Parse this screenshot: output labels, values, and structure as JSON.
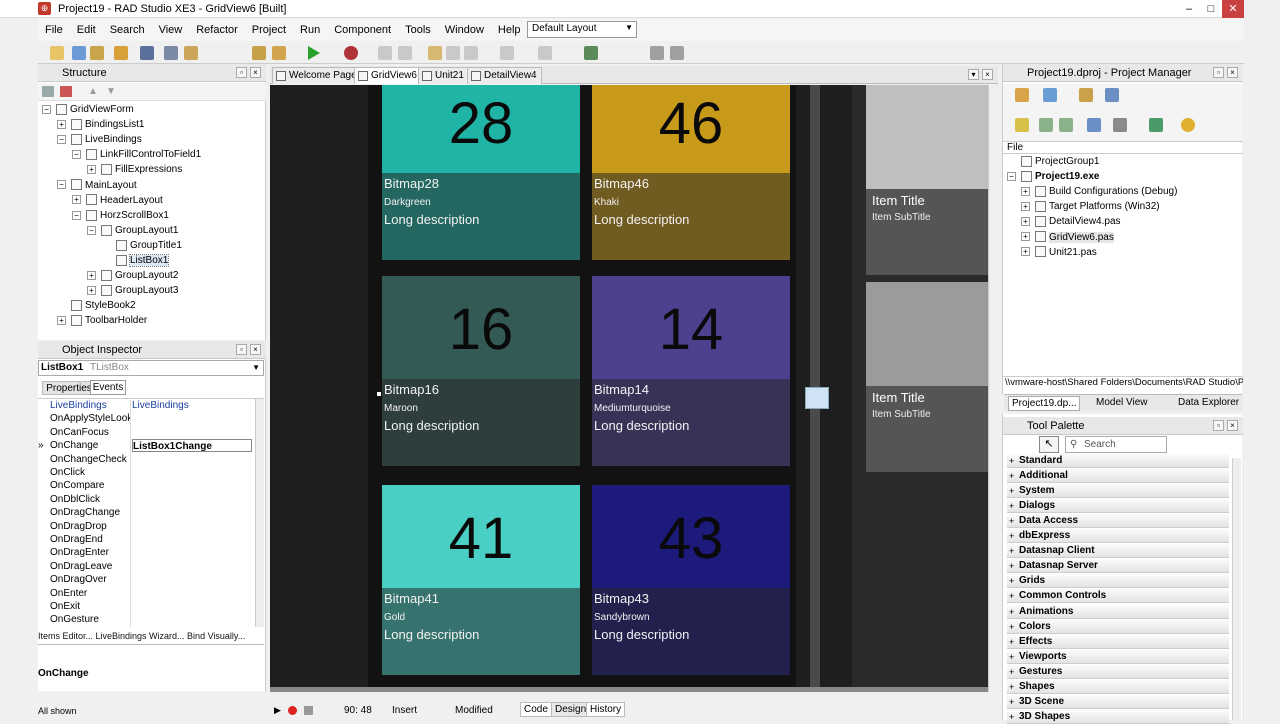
{
  "window": {
    "title": "Project19 - RAD Studio XE3 - GridView6 [Built]",
    "min": "–",
    "max": "□",
    "close": "✕"
  },
  "menu": [
    "File",
    "Edit",
    "Search",
    "View",
    "Refactor",
    "Project",
    "Run",
    "Component",
    "Tools",
    "Window",
    "Help"
  ],
  "layout": {
    "selected": "Default Layout"
  },
  "structure": {
    "title": "Structure",
    "rows": [
      {
        "label": "GridViewForm",
        "exp": "−",
        "depth": 0
      },
      {
        "label": "BindingsList1",
        "exp": "+",
        "depth": 1
      },
      {
        "label": "LiveBindings",
        "exp": "−",
        "depth": 1
      },
      {
        "label": "LinkFillControlToField1",
        "exp": "−",
        "depth": 2
      },
      {
        "label": "FillExpressions",
        "exp": "+",
        "depth": 3
      },
      {
        "label": "MainLayout",
        "exp": "−",
        "depth": 1
      },
      {
        "label": "HeaderLayout",
        "exp": "+",
        "depth": 2
      },
      {
        "label": "HorzScrollBox1",
        "exp": "−",
        "depth": 2
      },
      {
        "label": "GroupLayout1",
        "exp": "−",
        "depth": 3
      },
      {
        "label": "GroupTitle1",
        "exp": "",
        "depth": 4
      },
      {
        "label": "ListBox1",
        "exp": "",
        "depth": 4
      },
      {
        "label": "GroupLayout2",
        "exp": "+",
        "depth": 3
      },
      {
        "label": "GroupLayout3",
        "exp": "+",
        "depth": 3
      },
      {
        "label": "StyleBook2",
        "exp": "",
        "depth": 1
      },
      {
        "label": "ToolbarHolder",
        "exp": "+",
        "depth": 1
      }
    ]
  },
  "inspector": {
    "title": "Object Inspector",
    "object_name": "ListBox1",
    "object_type": "TListBox",
    "tabs": [
      "Properties",
      "Events"
    ],
    "rows": [
      {
        "name": "LiveBindings",
        "value": "LiveBindings"
      },
      {
        "name": "OnApplyStyleLookup",
        "value": ""
      },
      {
        "name": "OnCanFocus",
        "value": ""
      },
      {
        "name": "OnChange",
        "value": "ListBox1Change"
      },
      {
        "name": "OnChangeCheck",
        "value": ""
      },
      {
        "name": "OnClick",
        "value": ""
      },
      {
        "name": "OnCompare",
        "value": ""
      },
      {
        "name": "OnDblClick",
        "value": ""
      },
      {
        "name": "OnDragChange",
        "value": ""
      },
      {
        "name": "OnDragDrop",
        "value": ""
      },
      {
        "name": "OnDragEnd",
        "value": ""
      },
      {
        "name": "OnDragEnter",
        "value": ""
      },
      {
        "name": "OnDragLeave",
        "value": ""
      },
      {
        "name": "OnDragOver",
        "value": ""
      },
      {
        "name": "OnEnter",
        "value": ""
      },
      {
        "name": "OnExit",
        "value": ""
      },
      {
        "name": "OnGesture",
        "value": ""
      }
    ],
    "links": "Items Editor...  LiveBindings Wizard...  Bind Visually...",
    "selected_event": "OnChange",
    "footer": "All shown"
  },
  "editor": {
    "tabs": [
      "Welcome Page",
      "GridView6",
      "Unit21",
      "DetailView4"
    ],
    "tiles": [
      {
        "number": "28",
        "title": "Bitmap28",
        "subtitle": "Darkgreen",
        "desc": "Long description",
        "color": "#20b4a6"
      },
      {
        "number": "46",
        "title": "Bitmap46",
        "subtitle": "Khaki",
        "desc": "Long description",
        "color": "#c89a1a"
      },
      {
        "number": "16",
        "title": "Bitmap16",
        "subtitle": "Maroon",
        "desc": "Long description",
        "color": "#335a55"
      },
      {
        "number": "14",
        "title": "Bitmap14",
        "subtitle": "Mediumturquoise",
        "desc": "Long description",
        "color": "#4f3f8f"
      },
      {
        "number": "41",
        "title": "Bitmap41",
        "subtitle": "Gold",
        "desc": "Long description",
        "color": "#49cfc4"
      },
      {
        "number": "43",
        "title": "Bitmap43",
        "subtitle": "Sandybrown",
        "desc": "Long description",
        "color": "#1c1a7a"
      }
    ],
    "details": [
      {
        "title": "Item Title",
        "subtitle": "Item SubTitle",
        "img": "#bfbfbf"
      },
      {
        "title": "Item Title",
        "subtitle": "Item SubTitle",
        "img": "#9b9b9b"
      }
    ],
    "status": {
      "pos": "90:  48",
      "mode": "Insert",
      "state": "Modified",
      "views": [
        "Code",
        "Design",
        "History"
      ]
    }
  },
  "project_manager": {
    "title": "Project19.dproj - Project Manager",
    "col": "File",
    "rows": [
      {
        "label": "ProjectGroup1",
        "bold": false,
        "depth": 0,
        "exp": ""
      },
      {
        "label": "Project19.exe",
        "bold": true,
        "depth": 0,
        "exp": "−"
      },
      {
        "label": "Build Configurations (Debug)",
        "bold": false,
        "depth": 1,
        "exp": "+"
      },
      {
        "label": "Target Platforms (Win32)",
        "bold": false,
        "depth": 1,
        "exp": "+"
      },
      {
        "label": "DetailView4.pas",
        "bold": false,
        "depth": 1,
        "exp": "+"
      },
      {
        "label": "GridView6.pas",
        "bold": false,
        "depth": 1,
        "exp": "+"
      },
      {
        "label": "Unit21.pas",
        "bold": false,
        "depth": 1,
        "exp": "+"
      }
    ],
    "path": "\\\\vmware-host\\Shared Folders\\Documents\\RAD Studio\\Proj",
    "tabs": [
      "Project19.dp...",
      "Model View",
      "Data Explorer"
    ]
  },
  "palette": {
    "title": "Tool Palette",
    "search_placeholder": "Search",
    "categories": [
      "Standard",
      "Additional",
      "System",
      "Dialogs",
      "Data Access",
      "dbExpress",
      "Datasnap Client",
      "Datasnap Server",
      "Grids",
      "Common Controls",
      "Animations",
      "Colors",
      "Effects",
      "Viewports",
      "Gestures",
      "Shapes",
      "3D Scene",
      "3D Shapes"
    ]
  }
}
